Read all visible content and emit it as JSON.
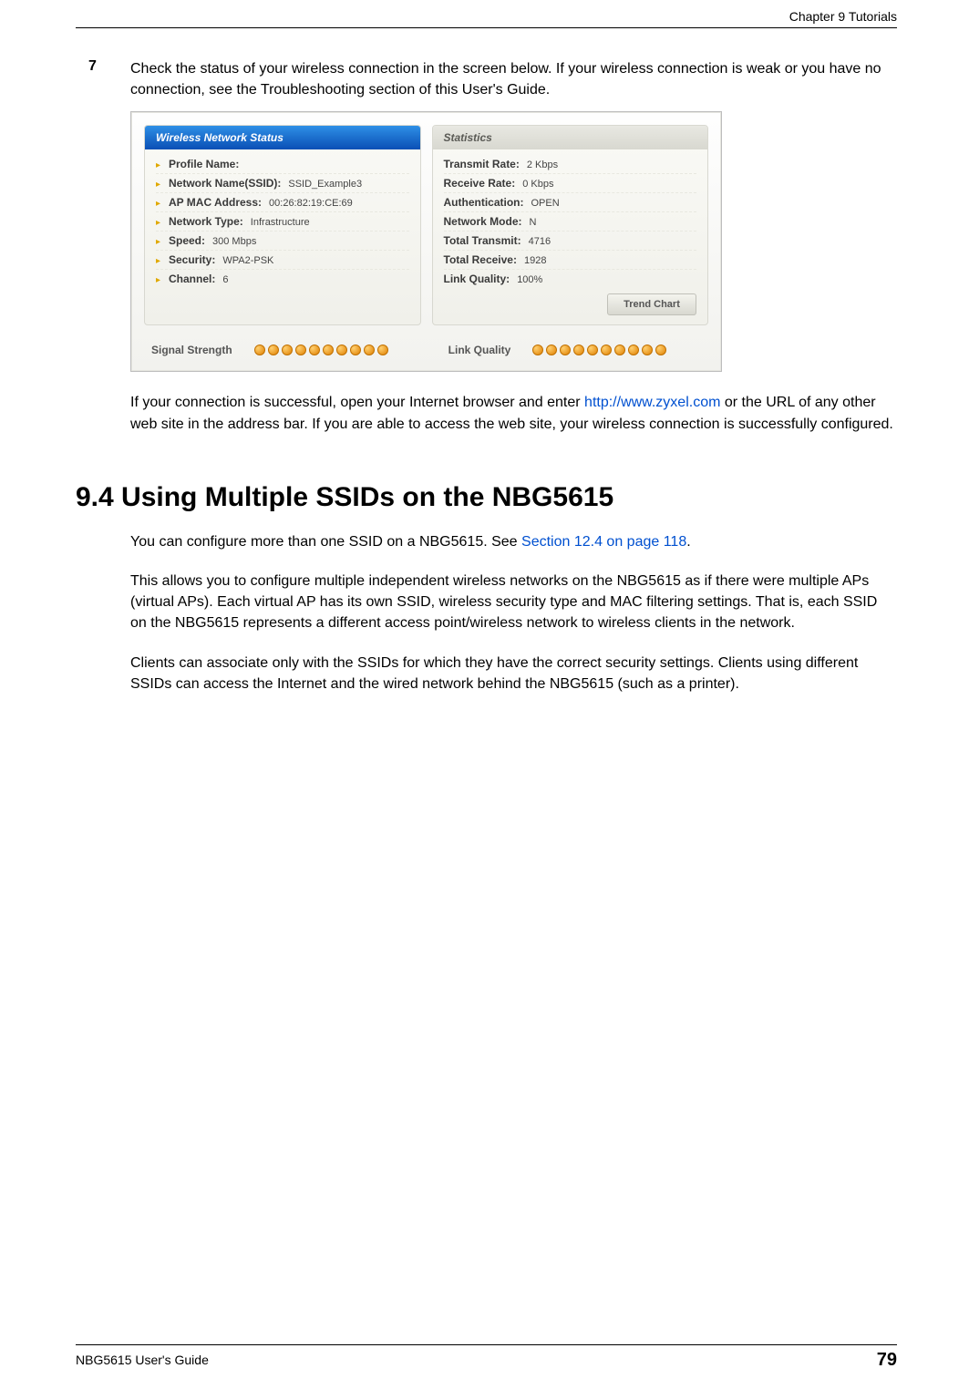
{
  "header": {
    "chapter": "Chapter 9 Tutorials"
  },
  "step": {
    "number": "7",
    "text": "Check the status of your wireless connection in the screen below. If your wireless connection is weak or you have no connection, see the Troubleshooting section of this User's Guide."
  },
  "screenshot": {
    "left_panel": {
      "title": "Wireless Network Status",
      "rows": [
        {
          "label": "Profile Name:",
          "value": ""
        },
        {
          "label": "Network Name(SSID):",
          "value": "SSID_Example3"
        },
        {
          "label": "AP MAC Address:",
          "value": "00:26:82:19:CE:69"
        },
        {
          "label": "Network Type:",
          "value": "Infrastructure"
        },
        {
          "label": "Speed:",
          "value": "300 Mbps"
        },
        {
          "label": "Security:",
          "value": "WPA2-PSK"
        },
        {
          "label": "Channel:",
          "value": "6"
        }
      ]
    },
    "right_panel": {
      "title": "Statistics",
      "rows": [
        {
          "label": "Transmit Rate:",
          "value": "2 Kbps"
        },
        {
          "label": "Receive Rate:",
          "value": "0 Kbps"
        },
        {
          "label": "Authentication:",
          "value": "OPEN"
        },
        {
          "label": "Network Mode:",
          "value": "N"
        },
        {
          "label": "Total Transmit:",
          "value": "4716"
        },
        {
          "label": "Total Receive:",
          "value": "1928"
        },
        {
          "label": "Link Quality:",
          "value": "100%"
        }
      ],
      "button": "Trend Chart"
    },
    "bottom": {
      "signal_label": "Signal Strength",
      "quality_label": "Link Quality",
      "dots": 10
    }
  },
  "after": {
    "part1": "If your connection is successful, open your Internet browser and enter ",
    "link": "http://www.zyxel.com",
    "part2": " or the URL of any other web site in the address bar. If you are able to access the web site, your wireless connection is successfully configured."
  },
  "section": {
    "title": "9.4  Using Multiple SSIDs on the NBG5615",
    "p1a": "You can configure more than one SSID on a NBG5615. See ",
    "p1link": "Section 12.4 on page 118",
    "p1b": ".",
    "p2": "This allows you to configure multiple independent wireless networks on the NBG5615 as if there were multiple APs (virtual APs). Each virtual AP has its own SSID, wireless security type and MAC filtering settings. That is, each SSID on the NBG5615 represents a different access point/wireless network to wireless clients in the network.",
    "p3": "Clients can associate only with the SSIDs for which they have the correct security settings. Clients using different SSIDs can access the Internet and the wired network behind the NBG5615 (such as a printer)."
  },
  "footer": {
    "guide": "NBG5615 User's Guide",
    "page": "79"
  }
}
